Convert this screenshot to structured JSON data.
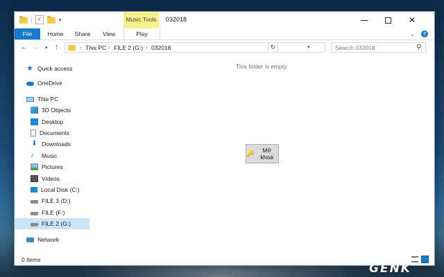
{
  "window": {
    "title": "032018",
    "contextual_tab_group": "Music Tools"
  },
  "ribbon": {
    "tabs": [
      {
        "label": "File"
      },
      {
        "label": "Home"
      },
      {
        "label": "Share"
      },
      {
        "label": "View"
      },
      {
        "label": "Play"
      }
    ]
  },
  "address": {
    "breadcrumb": [
      "This PC",
      "FILE 2 (G:)",
      "032018"
    ],
    "search_placeholder": "Search 032018"
  },
  "sidebar": {
    "items": [
      {
        "label": "Quick access",
        "icon": "star-icon"
      },
      {
        "label": "OneDrive",
        "icon": "cloud-icon"
      },
      {
        "label": "This PC",
        "icon": "computer-icon"
      },
      {
        "label": "3D Objects",
        "icon": "cube-icon"
      },
      {
        "label": "Desktop",
        "icon": "desktop-icon"
      },
      {
        "label": "Documents",
        "icon": "document-icon"
      },
      {
        "label": "Downloads",
        "icon": "download-icon"
      },
      {
        "label": "Music",
        "icon": "music-icon"
      },
      {
        "label": "Pictures",
        "icon": "picture-icon"
      },
      {
        "label": "Videos",
        "icon": "video-icon"
      },
      {
        "label": "Local Disk (C:)",
        "icon": "windows-drive-icon"
      },
      {
        "label": "FILE 3 (D:)",
        "icon": "drive-icon"
      },
      {
        "label": "FILE (F:)",
        "icon": "drive-icon"
      },
      {
        "label": "FILE 2 (G:)",
        "icon": "drive-icon",
        "selected": true
      },
      {
        "label": "Network",
        "icon": "network-icon"
      }
    ]
  },
  "content": {
    "empty_message": "This folder is empty.",
    "unlock_button": "Mở khoá"
  },
  "status": {
    "item_count": "0 items"
  },
  "watermark": "GENK",
  "colors": {
    "accent": "#1979ca",
    "contextual_tab": "#f7f08c",
    "selection": "#cce4f7"
  }
}
